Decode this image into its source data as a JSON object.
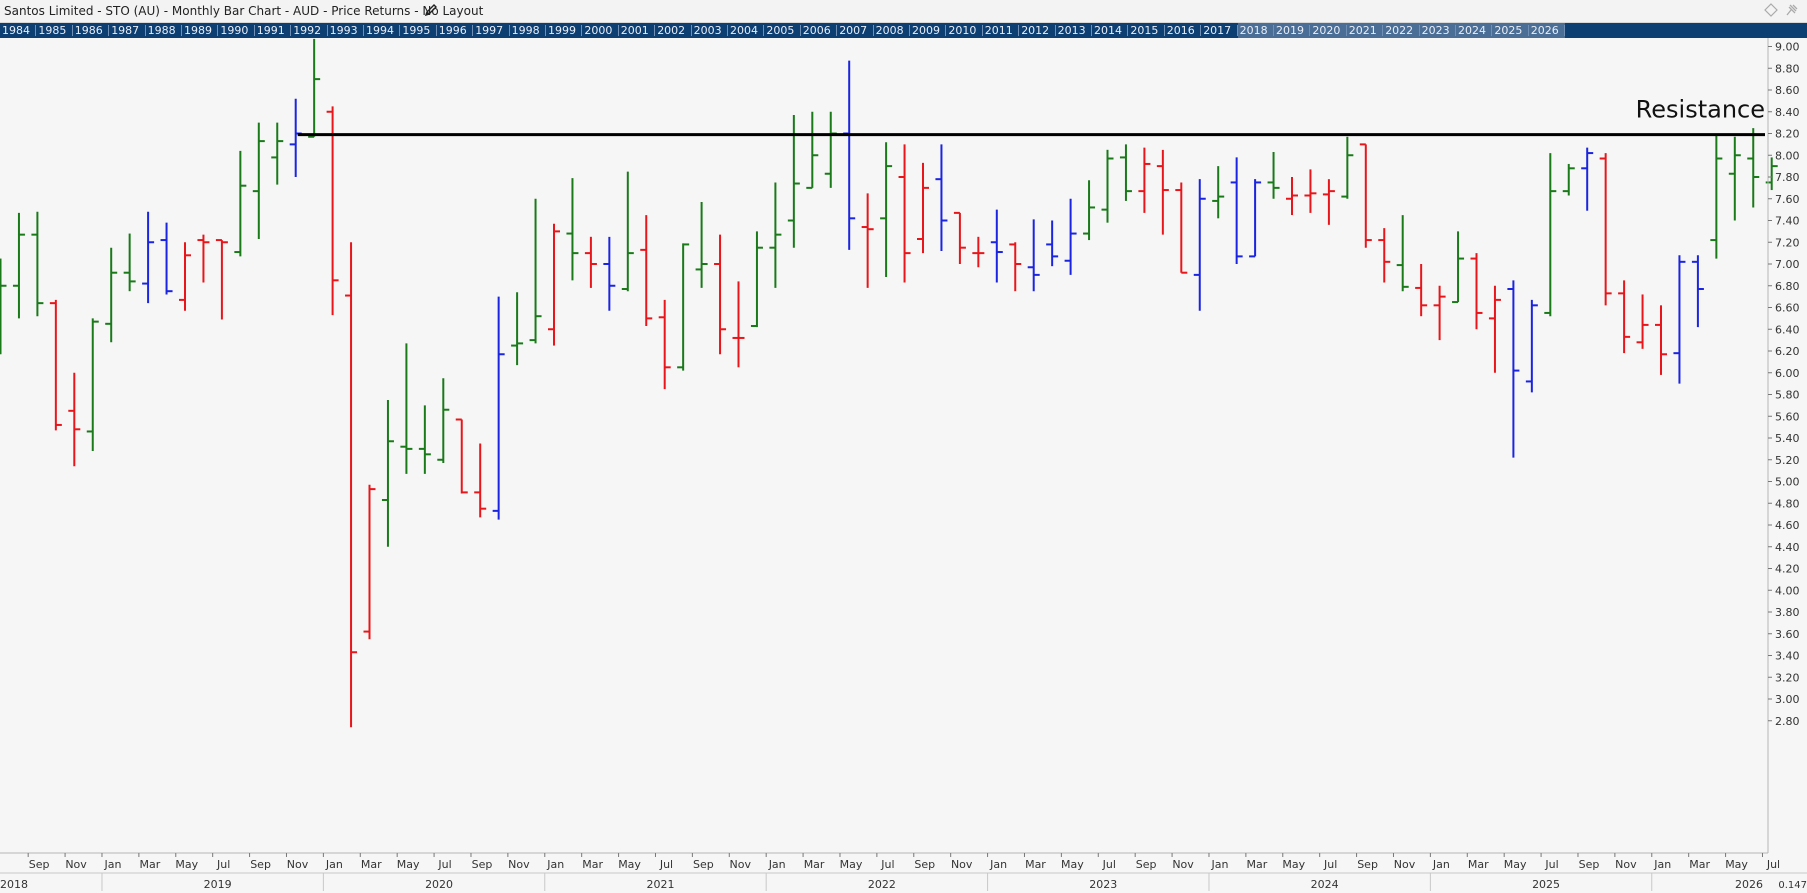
{
  "header": {
    "title": "Santos Limited - STO (AU) - Monthly Bar Chart - AUD - Price Returns - No Layout"
  },
  "year_strip": [
    "1984",
    "1985",
    "1986",
    "1987",
    "1988",
    "1989",
    "1990",
    "1991",
    "1992",
    "1993",
    "1994",
    "1995",
    "1996",
    "1997",
    "1998",
    "1999",
    "2000",
    "2001",
    "2002",
    "2003",
    "2004",
    "2005",
    "2006",
    "2007",
    "2008",
    "2009",
    "2010",
    "2011",
    "2012",
    "2013",
    "2014",
    "2015",
    "2016",
    "2017",
    "2018",
    "2019",
    "2020",
    "2021",
    "2022",
    "2023",
    "2024",
    "2025",
    "2026"
  ],
  "colors": {
    "up": "#1a7a1a",
    "down": "#e8161b",
    "neutral": "#1b24e0",
    "line": "#000000",
    "year_strip_bg": "#0e3f72",
    "plot_bg": "#f6f6f6"
  },
  "chart_data": {
    "type": "bar",
    "subtype": "ohlc",
    "period": "Monthly",
    "currency": "AUD",
    "x_range": [
      "2018-07",
      "2026-07"
    ],
    "ylim": [
      2.7,
      9.1
    ],
    "y_ticks": [
      2.8,
      3.0,
      3.2,
      3.4,
      3.6,
      3.8,
      4.0,
      4.2,
      4.4,
      4.6,
      4.8,
      5.0,
      5.2,
      5.4,
      5.6,
      5.8,
      6.0,
      6.2,
      6.4,
      6.6,
      6.8,
      7.0,
      7.2,
      7.4,
      7.6,
      7.8,
      8.0,
      8.2,
      8.4,
      8.6,
      8.8,
      9.0
    ],
    "y_tick_labels": [
      "2.80",
      "3.00",
      "3.20",
      "3.40",
      "3.60",
      "3.80",
      "4.00",
      "4.20",
      "4.40",
      "4.60",
      "4.80",
      "5.00",
      "5.20",
      "5.40",
      "5.60",
      "5.80",
      "6.00",
      "6.20",
      "6.40",
      "6.60",
      "6.80",
      "7.00",
      "7.20",
      "7.40",
      "7.60",
      "7.80",
      "8.00",
      "8.20",
      "8.40",
      "8.60",
      "8.80",
      "9.00"
    ],
    "month_labels": [
      {
        "date": "2018-09",
        "label": "Sep"
      },
      {
        "date": "2018-11",
        "label": "Nov"
      },
      {
        "date": "2019-01",
        "label": "Jan"
      },
      {
        "date": "2019-03",
        "label": "Mar"
      },
      {
        "date": "2019-05",
        "label": "May"
      },
      {
        "date": "2019-07",
        "label": "Jul"
      },
      {
        "date": "2019-09",
        "label": "Sep"
      },
      {
        "date": "2019-11",
        "label": "Nov"
      },
      {
        "date": "2020-01",
        "label": "Jan"
      },
      {
        "date": "2020-03",
        "label": "Mar"
      },
      {
        "date": "2020-05",
        "label": "May"
      },
      {
        "date": "2020-07",
        "label": "Jul"
      },
      {
        "date": "2020-09",
        "label": "Sep"
      },
      {
        "date": "2020-11",
        "label": "Nov"
      },
      {
        "date": "2021-01",
        "label": "Jan"
      },
      {
        "date": "2021-03",
        "label": "Mar"
      },
      {
        "date": "2021-05",
        "label": "May"
      },
      {
        "date": "2021-07",
        "label": "Jul"
      },
      {
        "date": "2021-09",
        "label": "Sep"
      },
      {
        "date": "2021-11",
        "label": "Nov"
      },
      {
        "date": "2022-01",
        "label": "Jan"
      },
      {
        "date": "2022-03",
        "label": "Mar"
      },
      {
        "date": "2022-05",
        "label": "May"
      },
      {
        "date": "2022-07",
        "label": "Jul"
      },
      {
        "date": "2022-09",
        "label": "Sep"
      },
      {
        "date": "2022-11",
        "label": "Nov"
      },
      {
        "date": "2023-01",
        "label": "Jan"
      },
      {
        "date": "2023-03",
        "label": "Mar"
      },
      {
        "date": "2023-05",
        "label": "May"
      },
      {
        "date": "2023-07",
        "label": "Jul"
      },
      {
        "date": "2023-09",
        "label": "Sep"
      },
      {
        "date": "2023-11",
        "label": "Nov"
      },
      {
        "date": "2024-01",
        "label": "Jan"
      },
      {
        "date": "2024-03",
        "label": "Mar"
      },
      {
        "date": "2024-05",
        "label": "May"
      },
      {
        "date": "2024-07",
        "label": "Jul"
      },
      {
        "date": "2024-09",
        "label": "Sep"
      },
      {
        "date": "2024-11",
        "label": "Nov"
      },
      {
        "date": "2025-01",
        "label": "Jan"
      },
      {
        "date": "2025-03",
        "label": "Mar"
      },
      {
        "date": "2025-05",
        "label": "May"
      },
      {
        "date": "2025-07",
        "label": "Jul"
      },
      {
        "date": "2025-09",
        "label": "Sep"
      },
      {
        "date": "2025-11",
        "label": "Nov"
      },
      {
        "date": "2026-01",
        "label": "Jan"
      },
      {
        "date": "2026-03",
        "label": "Mar"
      },
      {
        "date": "2026-05",
        "label": "May"
      },
      {
        "date": "2026-07",
        "label": "Jul"
      }
    ],
    "year_labels": [
      {
        "date": "2018-07",
        "label": "2018"
      },
      {
        "date": "2019-07",
        "label": "2019"
      },
      {
        "date": "2020-07",
        "label": "2020"
      },
      {
        "date": "2021-07",
        "label": "2021"
      },
      {
        "date": "2022-07",
        "label": "2022"
      },
      {
        "date": "2023-07",
        "label": "2023"
      },
      {
        "date": "2024-07",
        "label": "2024"
      },
      {
        "date": "2025-07",
        "label": "2025"
      },
      {
        "date": "2026-06",
        "label": "2026"
      }
    ],
    "year_boundaries": [
      "2019-01",
      "2020-01",
      "2021-01",
      "2022-01",
      "2023-01",
      "2024-01",
      "2025-01",
      "2026-01"
    ],
    "corner_label": "0.147",
    "bars": [
      {
        "date": "2018-07",
        "o": 6.78,
        "h": 7.05,
        "l": 6.17,
        "c": 6.8,
        "dir": "up"
      },
      {
        "date": "2018-08",
        "o": 6.8,
        "h": 7.47,
        "l": 6.5,
        "c": 7.27,
        "dir": "up"
      },
      {
        "date": "2018-09",
        "o": 7.27,
        "h": 7.48,
        "l": 6.52,
        "c": 6.64,
        "dir": "up"
      },
      {
        "date": "2018-10",
        "o": 6.64,
        "h": 6.67,
        "l": 5.47,
        "c": 5.52,
        "dir": "down"
      },
      {
        "date": "2018-11",
        "o": 5.65,
        "h": 6.0,
        "l": 5.14,
        "c": 5.48,
        "dir": "down"
      },
      {
        "date": "2018-12",
        "o": 5.46,
        "h": 6.5,
        "l": 5.28,
        "c": 6.47,
        "dir": "up"
      },
      {
        "date": "2019-01",
        "o": 6.45,
        "h": 7.15,
        "l": 6.28,
        "c": 6.92,
        "dir": "up"
      },
      {
        "date": "2019-02",
        "o": 6.92,
        "h": 7.28,
        "l": 6.75,
        "c": 6.84,
        "dir": "up"
      },
      {
        "date": "2019-03",
        "o": 6.82,
        "h": 7.48,
        "l": 6.64,
        "c": 7.2,
        "dir": "neutral"
      },
      {
        "date": "2019-04",
        "o": 7.22,
        "h": 7.38,
        "l": 6.72,
        "c": 6.75,
        "dir": "neutral"
      },
      {
        "date": "2019-05",
        "o": 6.67,
        "h": 7.2,
        "l": 6.57,
        "c": 7.08,
        "dir": "down"
      },
      {
        "date": "2019-06",
        "o": 7.22,
        "h": 7.27,
        "l": 6.83,
        "c": 7.2,
        "dir": "down"
      },
      {
        "date": "2019-07",
        "o": 7.22,
        "h": 7.22,
        "l": 6.49,
        "c": 7.2,
        "dir": "down"
      },
      {
        "date": "2019-08",
        "o": 7.11,
        "h": 8.04,
        "l": 7.07,
        "c": 7.72,
        "dir": "up"
      },
      {
        "date": "2019-09",
        "o": 7.67,
        "h": 8.3,
        "l": 7.23,
        "c": 8.13,
        "dir": "up"
      },
      {
        "date": "2019-10",
        "o": 7.98,
        "h": 8.3,
        "l": 7.73,
        "c": 8.13,
        "dir": "up"
      },
      {
        "date": "2019-11",
        "o": 8.1,
        "h": 8.52,
        "l": 7.8,
        "c": 8.2,
        "dir": "neutral"
      },
      {
        "date": "2019-12",
        "o": 8.17,
        "h": 9.07,
        "l": 8.17,
        "c": 8.7,
        "dir": "up"
      },
      {
        "date": "2020-01",
        "o": 8.4,
        "h": 8.45,
        "l": 6.53,
        "c": 6.85,
        "dir": "down"
      },
      {
        "date": "2020-02",
        "o": 6.71,
        "h": 7.2,
        "l": 2.74,
        "c": 3.43,
        "dir": "down"
      },
      {
        "date": "2020-03",
        "o": 3.62,
        "h": 4.97,
        "l": 3.55,
        "c": 4.93,
        "dir": "down"
      },
      {
        "date": "2020-04",
        "o": 4.83,
        "h": 5.75,
        "l": 4.4,
        "c": 5.37,
        "dir": "up"
      },
      {
        "date": "2020-05",
        "o": 5.32,
        "h": 6.27,
        "l": 5.07,
        "c": 5.3,
        "dir": "up"
      },
      {
        "date": "2020-06",
        "o": 5.3,
        "h": 5.7,
        "l": 5.07,
        "c": 5.25,
        "dir": "up"
      },
      {
        "date": "2020-07",
        "o": 5.2,
        "h": 5.95,
        "l": 5.17,
        "c": 5.66,
        "dir": "up"
      },
      {
        "date": "2020-08",
        "o": 5.57,
        "h": 5.57,
        "l": 4.89,
        "c": 4.9,
        "dir": "down"
      },
      {
        "date": "2020-09",
        "o": 4.9,
        "h": 5.35,
        "l": 4.67,
        "c": 4.75,
        "dir": "down"
      },
      {
        "date": "2020-10",
        "o": 4.73,
        "h": 6.7,
        "l": 4.65,
        "c": 6.17,
        "dir": "neutral"
      },
      {
        "date": "2020-11",
        "o": 6.25,
        "h": 6.74,
        "l": 6.07,
        "c": 6.27,
        "dir": "up"
      },
      {
        "date": "2020-12",
        "o": 6.3,
        "h": 7.6,
        "l": 6.27,
        "c": 6.52,
        "dir": "up"
      },
      {
        "date": "2021-01",
        "o": 6.4,
        "h": 7.37,
        "l": 6.25,
        "c": 7.3,
        "dir": "down"
      },
      {
        "date": "2021-02",
        "o": 7.28,
        "h": 7.79,
        "l": 6.85,
        "c": 7.1,
        "dir": "up"
      },
      {
        "date": "2021-03",
        "o": 7.1,
        "h": 7.25,
        "l": 6.78,
        "c": 7.0,
        "dir": "down"
      },
      {
        "date": "2021-04",
        "o": 7.0,
        "h": 7.25,
        "l": 6.57,
        "c": 6.8,
        "dir": "neutral"
      },
      {
        "date": "2021-05",
        "o": 6.77,
        "h": 7.85,
        "l": 6.75,
        "c": 7.1,
        "dir": "up"
      },
      {
        "date": "2021-06",
        "o": 7.13,
        "h": 7.45,
        "l": 6.43,
        "c": 6.5,
        "dir": "down"
      },
      {
        "date": "2021-07",
        "o": 6.51,
        "h": 6.67,
        "l": 5.85,
        "c": 6.05,
        "dir": "down"
      },
      {
        "date": "2021-08",
        "o": 6.05,
        "h": 7.19,
        "l": 6.02,
        "c": 7.18,
        "dir": "up"
      },
      {
        "date": "2021-09",
        "o": 6.95,
        "h": 7.57,
        "l": 6.78,
        "c": 7.0,
        "dir": "up"
      },
      {
        "date": "2021-10",
        "o": 7.0,
        "h": 7.27,
        "l": 6.17,
        "c": 6.4,
        "dir": "down"
      },
      {
        "date": "2021-11",
        "o": 6.32,
        "h": 6.84,
        "l": 6.05,
        "c": 6.32,
        "dir": "down"
      },
      {
        "date": "2021-12",
        "o": 6.43,
        "h": 7.3,
        "l": 6.42,
        "c": 7.15,
        "dir": "up"
      },
      {
        "date": "2022-01",
        "o": 7.15,
        "h": 7.75,
        "l": 6.78,
        "c": 7.27,
        "dir": "up"
      },
      {
        "date": "2022-02",
        "o": 7.4,
        "h": 8.37,
        "l": 7.15,
        "c": 7.74,
        "dir": "up"
      },
      {
        "date": "2022-03",
        "o": 7.7,
        "h": 8.4,
        "l": 7.7,
        "c": 8.0,
        "dir": "up"
      },
      {
        "date": "2022-04",
        "o": 7.83,
        "h": 8.4,
        "l": 7.7,
        "c": 8.2,
        "dir": "up"
      },
      {
        "date": "2022-05",
        "o": 8.2,
        "h": 8.87,
        "l": 7.13,
        "c": 7.42,
        "dir": "neutral"
      },
      {
        "date": "2022-06",
        "o": 7.34,
        "h": 7.65,
        "l": 6.78,
        "c": 7.32,
        "dir": "down"
      },
      {
        "date": "2022-07",
        "o": 7.42,
        "h": 8.12,
        "l": 6.88,
        "c": 7.9,
        "dir": "up"
      },
      {
        "date": "2022-08",
        "o": 7.8,
        "h": 8.1,
        "l": 6.83,
        "c": 7.1,
        "dir": "down"
      },
      {
        "date": "2022-09",
        "o": 7.23,
        "h": 7.93,
        "l": 7.1,
        "c": 7.7,
        "dir": "down"
      },
      {
        "date": "2022-10",
        "o": 7.78,
        "h": 8.1,
        "l": 7.12,
        "c": 7.4,
        "dir": "neutral"
      },
      {
        "date": "2022-11",
        "o": 7.47,
        "h": 7.47,
        "l": 7.0,
        "c": 7.15,
        "dir": "down"
      },
      {
        "date": "2022-12",
        "o": 7.1,
        "h": 7.25,
        "l": 6.97,
        "c": 7.1,
        "dir": "down"
      },
      {
        "date": "2023-01",
        "o": 7.2,
        "h": 7.5,
        "l": 6.83,
        "c": 7.11,
        "dir": "neutral"
      },
      {
        "date": "2023-02",
        "o": 7.18,
        "h": 7.2,
        "l": 6.75,
        "c": 7.0,
        "dir": "down"
      },
      {
        "date": "2023-03",
        "o": 6.97,
        "h": 7.41,
        "l": 6.75,
        "c": 6.9,
        "dir": "neutral"
      },
      {
        "date": "2023-04",
        "o": 7.18,
        "h": 7.4,
        "l": 6.98,
        "c": 7.07,
        "dir": "neutral"
      },
      {
        "date": "2023-05",
        "o": 7.03,
        "h": 7.6,
        "l": 6.9,
        "c": 7.28,
        "dir": "neutral"
      },
      {
        "date": "2023-06",
        "o": 7.28,
        "h": 7.77,
        "l": 7.22,
        "c": 7.52,
        "dir": "up"
      },
      {
        "date": "2023-07",
        "o": 7.5,
        "h": 8.05,
        "l": 7.38,
        "c": 7.97,
        "dir": "up"
      },
      {
        "date": "2023-08",
        "o": 7.98,
        "h": 8.1,
        "l": 7.58,
        "c": 7.67,
        "dir": "up"
      },
      {
        "date": "2023-09",
        "o": 7.67,
        "h": 8.07,
        "l": 7.47,
        "c": 7.92,
        "dir": "down"
      },
      {
        "date": "2023-10",
        "o": 7.9,
        "h": 8.05,
        "l": 7.27,
        "c": 7.68,
        "dir": "down"
      },
      {
        "date": "2023-11",
        "o": 7.68,
        "h": 7.75,
        "l": 6.92,
        "c": 6.92,
        "dir": "down"
      },
      {
        "date": "2023-12",
        "o": 6.9,
        "h": 7.78,
        "l": 6.57,
        "c": 7.6,
        "dir": "neutral"
      },
      {
        "date": "2024-01",
        "o": 7.58,
        "h": 7.9,
        "l": 7.42,
        "c": 7.62,
        "dir": "up"
      },
      {
        "date": "2024-02",
        "o": 7.75,
        "h": 7.98,
        "l": 7.0,
        "c": 7.07,
        "dir": "neutral"
      },
      {
        "date": "2024-03",
        "o": 7.07,
        "h": 7.78,
        "l": 7.07,
        "c": 7.75,
        "dir": "neutral"
      },
      {
        "date": "2024-04",
        "o": 7.75,
        "h": 8.03,
        "l": 7.6,
        "c": 7.7,
        "dir": "up"
      },
      {
        "date": "2024-05",
        "o": 7.6,
        "h": 7.8,
        "l": 7.45,
        "c": 7.63,
        "dir": "down"
      },
      {
        "date": "2024-06",
        "o": 7.63,
        "h": 7.87,
        "l": 7.47,
        "c": 7.65,
        "dir": "down"
      },
      {
        "date": "2024-07",
        "o": 7.64,
        "h": 7.78,
        "l": 7.36,
        "c": 7.67,
        "dir": "down"
      },
      {
        "date": "2024-08",
        "o": 7.62,
        "h": 8.17,
        "l": 7.6,
        "c": 8.0,
        "dir": "up"
      },
      {
        "date": "2024-09",
        "o": 8.1,
        "h": 8.1,
        "l": 7.15,
        "c": 7.22,
        "dir": "down"
      },
      {
        "date": "2024-10",
        "o": 7.22,
        "h": 7.33,
        "l": 6.83,
        "c": 7.02,
        "dir": "down"
      },
      {
        "date": "2024-11",
        "o": 6.99,
        "h": 7.45,
        "l": 6.75,
        "c": 6.79,
        "dir": "up"
      },
      {
        "date": "2024-12",
        "o": 6.78,
        "h": 7.0,
        "l": 6.52,
        "c": 6.62,
        "dir": "down"
      },
      {
        "date": "2025-01",
        "o": 6.62,
        "h": 6.8,
        "l": 6.3,
        "c": 6.7,
        "dir": "down"
      },
      {
        "date": "2025-02",
        "o": 6.65,
        "h": 7.3,
        "l": 6.65,
        "c": 7.05,
        "dir": "up"
      },
      {
        "date": "2025-03",
        "o": 7.05,
        "h": 7.1,
        "l": 6.4,
        "c": 6.55,
        "dir": "down"
      },
      {
        "date": "2025-04",
        "o": 6.5,
        "h": 6.8,
        "l": 6.0,
        "c": 6.67,
        "dir": "down"
      },
      {
        "date": "2025-05",
        "o": 6.77,
        "h": 6.85,
        "l": 5.22,
        "c": 6.02,
        "dir": "neutral"
      },
      {
        "date": "2025-06",
        "o": 5.92,
        "h": 6.67,
        "l": 5.82,
        "c": 6.62,
        "dir": "neutral"
      },
      {
        "date": "2025-07",
        "o": 6.55,
        "h": 8.02,
        "l": 6.52,
        "c": 7.67,
        "dir": "up"
      },
      {
        "date": "2025-08",
        "o": 7.67,
        "h": 7.92,
        "l": 7.63,
        "c": 7.88,
        "dir": "up"
      },
      {
        "date": "2025-09",
        "o": 7.88,
        "h": 8.07,
        "l": 7.49,
        "c": 8.02,
        "dir": "neutral"
      },
      {
        "date": "2025-10",
        "o": 7.97,
        "h": 8.02,
        "l": 6.62,
        "c": 6.73,
        "dir": "down"
      },
      {
        "date": "2025-11",
        "o": 6.73,
        "h": 6.85,
        "l": 6.18,
        "c": 6.33,
        "dir": "down"
      },
      {
        "date": "2025-12",
        "o": 6.28,
        "h": 6.72,
        "l": 6.22,
        "c": 6.44,
        "dir": "down"
      },
      {
        "date": "2026-01",
        "o": 6.44,
        "h": 6.62,
        "l": 5.98,
        "c": 6.17,
        "dir": "down"
      },
      {
        "date": "2026-02",
        "o": 6.18,
        "h": 7.08,
        "l": 5.9,
        "c": 7.02,
        "dir": "neutral"
      },
      {
        "date": "2026-03",
        "o": 7.02,
        "h": 7.08,
        "l": 6.42,
        "c": 6.77,
        "dir": "neutral"
      },
      {
        "date": "2026-04",
        "o": 7.22,
        "h": 8.2,
        "l": 7.05,
        "c": 7.97,
        "dir": "up"
      },
      {
        "date": "2026-05",
        "o": 7.83,
        "h": 8.17,
        "l": 7.4,
        "c": 8.0,
        "dir": "up"
      },
      {
        "date": "2026-06",
        "o": 7.97,
        "h": 8.25,
        "l": 7.52,
        "c": 7.8,
        "dir": "up"
      },
      {
        "date": "2026-07",
        "o": 7.75,
        "h": 7.98,
        "l": 7.68,
        "c": 7.9,
        "dir": "up"
      }
    ],
    "annotations": [
      {
        "type": "horizontal_line",
        "label": "Resistance",
        "y": 8.19,
        "x_start": "2019-11",
        "x_end": "2026-07"
      }
    ]
  }
}
